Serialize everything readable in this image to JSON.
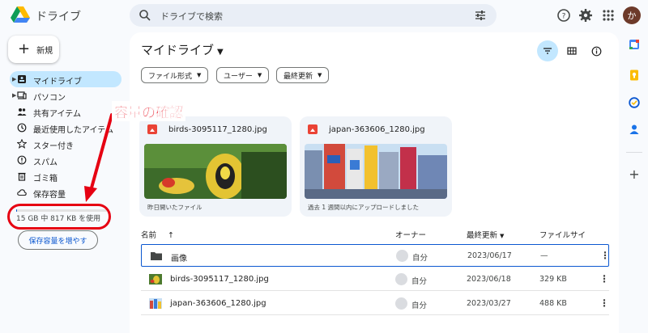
{
  "app": {
    "title": "ドライブ"
  },
  "search": {
    "placeholder": "ドライブで検索"
  },
  "avatar": {
    "initial": "か"
  },
  "sidebar": {
    "new_label": "新規",
    "items": [
      {
        "label": "マイドライブ",
        "icon": "my-drive-icon",
        "active": true
      },
      {
        "label": "パソコン",
        "icon": "computer-icon"
      },
      {
        "label": "共有アイテム",
        "icon": "shared-icon"
      },
      {
        "label": "最近使用したアイテム",
        "icon": "recent-icon"
      },
      {
        "label": "スター付き",
        "icon": "star-icon"
      },
      {
        "label": "スパム",
        "icon": "spam-icon"
      },
      {
        "label": "ゴミ箱",
        "icon": "trash-icon"
      },
      {
        "label": "保存容量",
        "icon": "cloud-icon"
      }
    ],
    "storage_text": "15 GB 中 817 KB を使用",
    "storage_fraction": 0.01,
    "buy_storage_label": "保存容量を増やす"
  },
  "annotation": {
    "label": "容量の確認",
    "color": "#e60012"
  },
  "main": {
    "title": "マイドライブ",
    "chips": [
      "ファイル形式",
      "ユーザー",
      "最終更新"
    ],
    "cards": [
      {
        "name": "birds-3095117_1280.jpg",
        "caption": "昨日開いたファイル"
      },
      {
        "name": "japan-363606_1280.jpg",
        "caption": "過去 1 週間以内にアップロードしました"
      }
    ],
    "columns": {
      "name": "名前",
      "owner": "オーナー",
      "modified": "最終更新",
      "size": "ファイルサイ"
    },
    "rows": [
      {
        "name": "画像",
        "type": "folder",
        "owner": "自分",
        "date": "2023/06/17",
        "size": "—"
      },
      {
        "name": "birds-3095117_1280.jpg",
        "type": "image",
        "owner": "自分",
        "date": "2023/06/18",
        "size": "329 KB"
      },
      {
        "name": "japan-363606_1280.jpg",
        "type": "image",
        "owner": "自分",
        "date": "2023/03/27",
        "size": "488 KB"
      }
    ]
  },
  "colors": {
    "accent": "#0b57d0",
    "selected_nav": "#c2e7ff",
    "panel_bg": "#f8fafd"
  }
}
